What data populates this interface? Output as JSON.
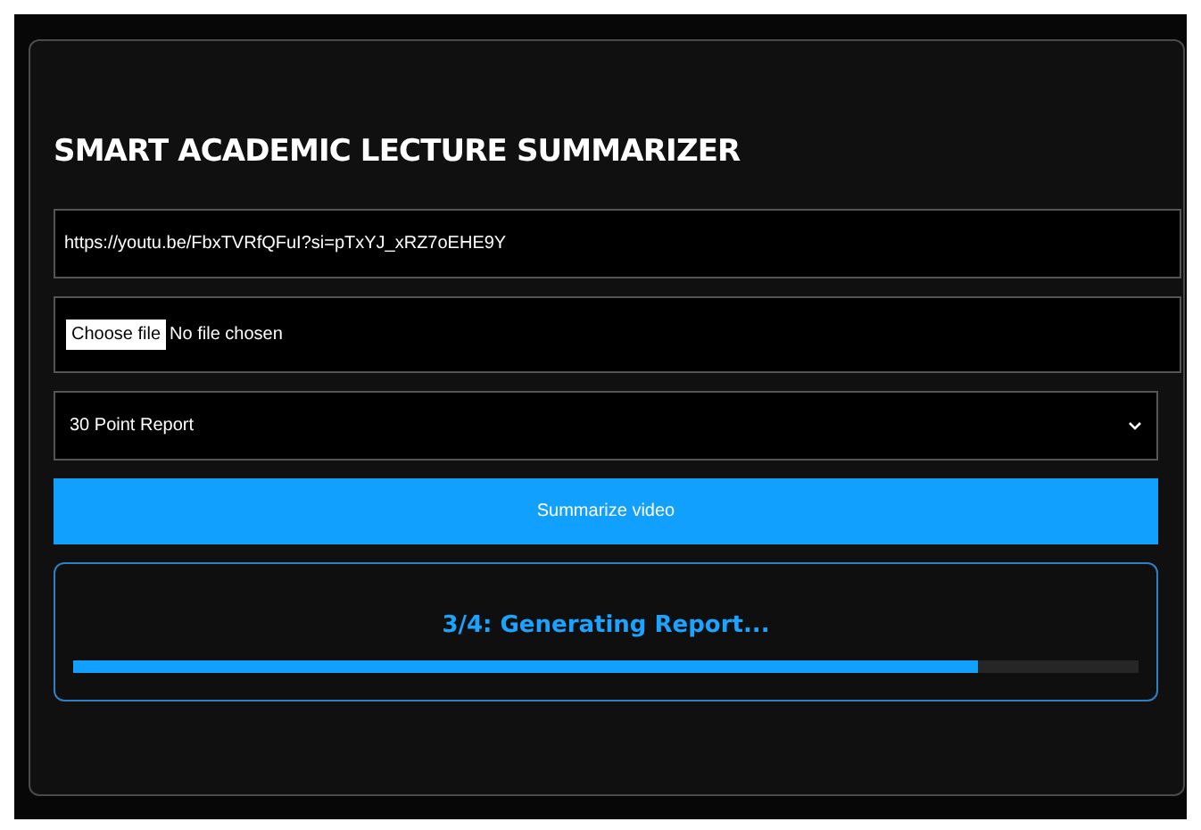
{
  "title": "SMART ACADEMIC LECTURE SUMMARIZER",
  "url_field": {
    "value": "https://youtu.be/FbxTVRfQFuI?si=pTxYJ_xRZ7oEHE9Y"
  },
  "file_field": {
    "button": "Choose file",
    "status": "No file chosen"
  },
  "report_select": {
    "value": "30 Point Report"
  },
  "submit_button": "Summarize video",
  "progress": {
    "status": "3/4: Generating Report...",
    "level": 0.85
  }
}
